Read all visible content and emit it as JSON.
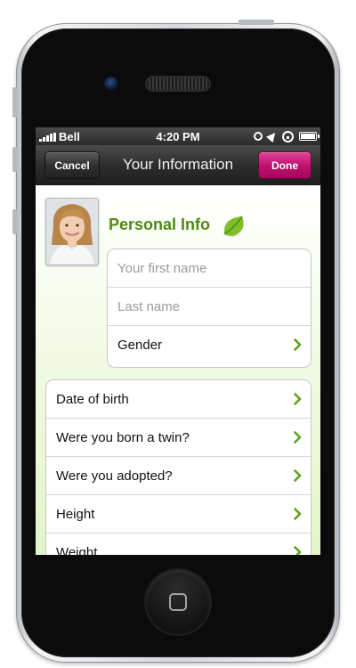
{
  "status_bar": {
    "carrier": "Bell",
    "time": "4:20 PM"
  },
  "nav": {
    "title": "Your Information",
    "cancel_label": "Cancel",
    "done_label": "Done"
  },
  "profile": {
    "section_title": "Personal Info",
    "first_name_placeholder": "Your first name",
    "last_name_placeholder": "Last name",
    "gender_label": "Gender"
  },
  "details": {
    "items": [
      {
        "label": "Date of birth"
      },
      {
        "label": "Were you born a twin?"
      },
      {
        "label": "Were you adopted?"
      },
      {
        "label": "Height"
      },
      {
        "label": "Weight"
      }
    ]
  },
  "colors": {
    "accent_green": "#4f8a12",
    "done_button": "#c2136f",
    "nav_bar": "#2e2e2e",
    "background_gradient_end": "#e2f5c8"
  },
  "icons": [
    "signal-icon",
    "alarm-icon",
    "location-icon",
    "rotation-lock-icon",
    "battery-icon",
    "leaf-icon",
    "chevron-right-icon"
  ]
}
